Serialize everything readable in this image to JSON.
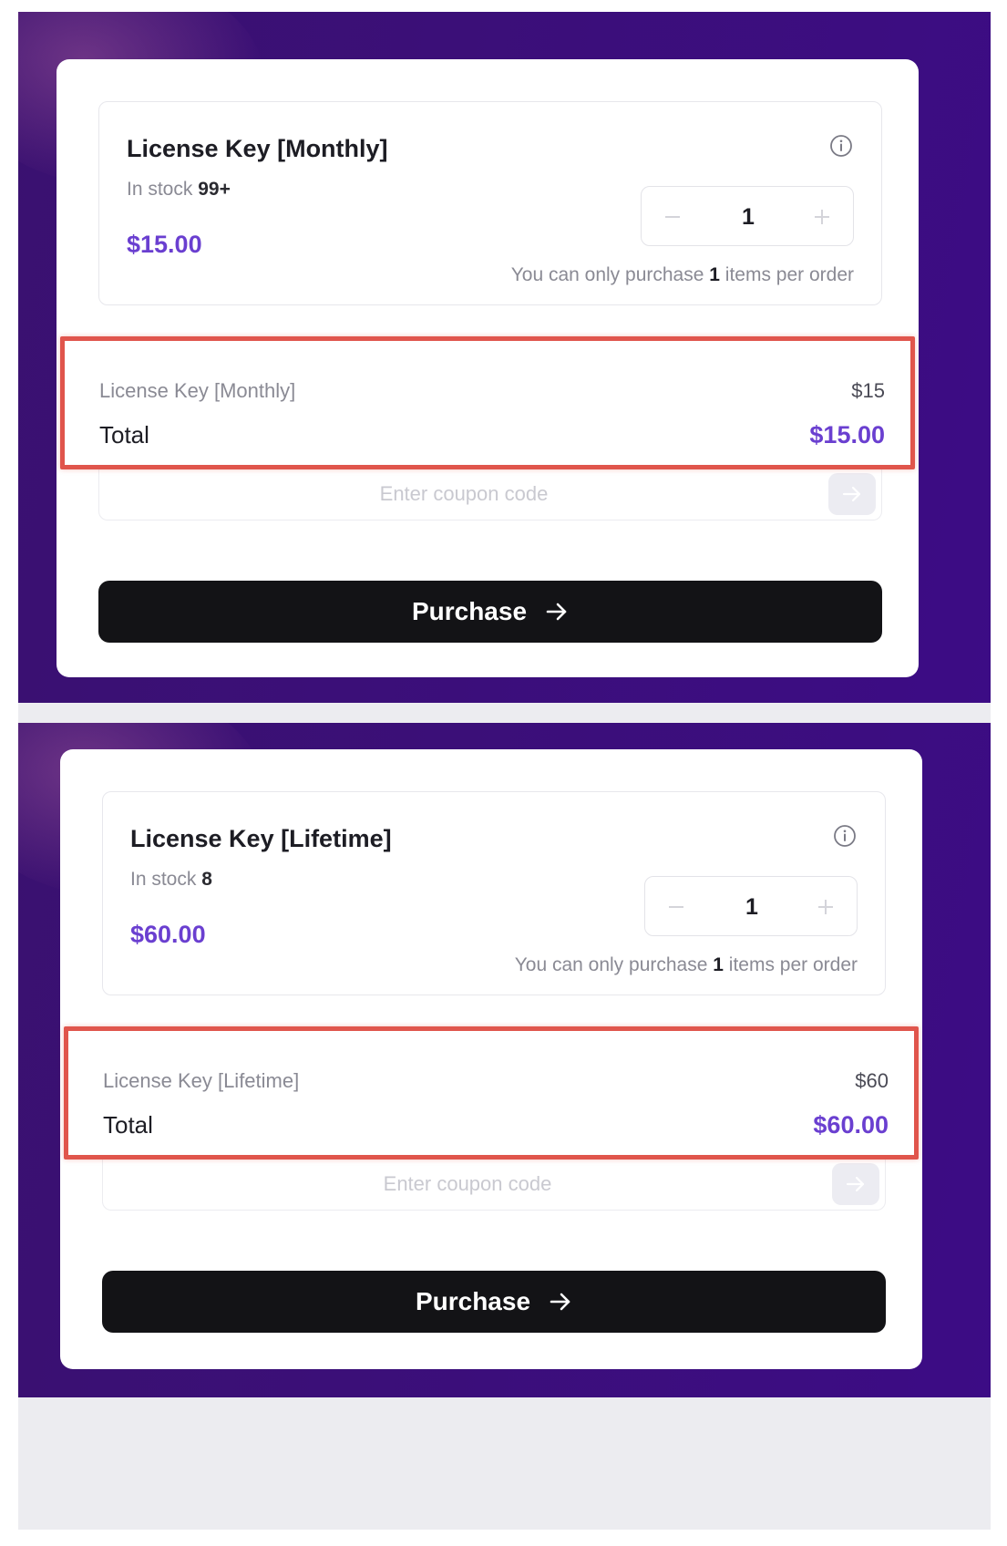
{
  "cards": [
    {
      "product_name": "License Key [Monthly]",
      "stock_label": "In stock",
      "stock_value": "99+",
      "price": "$15.00",
      "quantity": "1",
      "limit_prefix": "You can only purchase",
      "limit_value": "1",
      "limit_suffix": "items per order",
      "summary_item": "License Key [Monthly]",
      "summary_item_price": "$15",
      "total_label": "Total",
      "total_value": "$15.00",
      "coupon_placeholder": "Enter coupon code",
      "purchase_label": "Purchase"
    },
    {
      "product_name": "License Key [Lifetime]",
      "stock_label": "In stock",
      "stock_value": "8",
      "price": "$60.00",
      "quantity": "1",
      "limit_prefix": "You can only purchase",
      "limit_value": "1",
      "limit_suffix": "items per order",
      "summary_item": "License Key [Lifetime]",
      "summary_item_price": "$60",
      "total_label": "Total",
      "total_value": "$60.00",
      "coupon_placeholder": "Enter coupon code",
      "purchase_label": "Purchase"
    }
  ],
  "icons": {
    "info": "info-circle-icon",
    "minus": "minus-icon",
    "plus": "plus-icon",
    "coupon_submit": "arrow-right-icon",
    "purchase": "arrow-right-icon"
  },
  "colors": {
    "background_purple": "#3b0f78",
    "price_accent": "#6a3fd0",
    "highlight_border": "#e0554c",
    "button_dark": "#131316"
  }
}
